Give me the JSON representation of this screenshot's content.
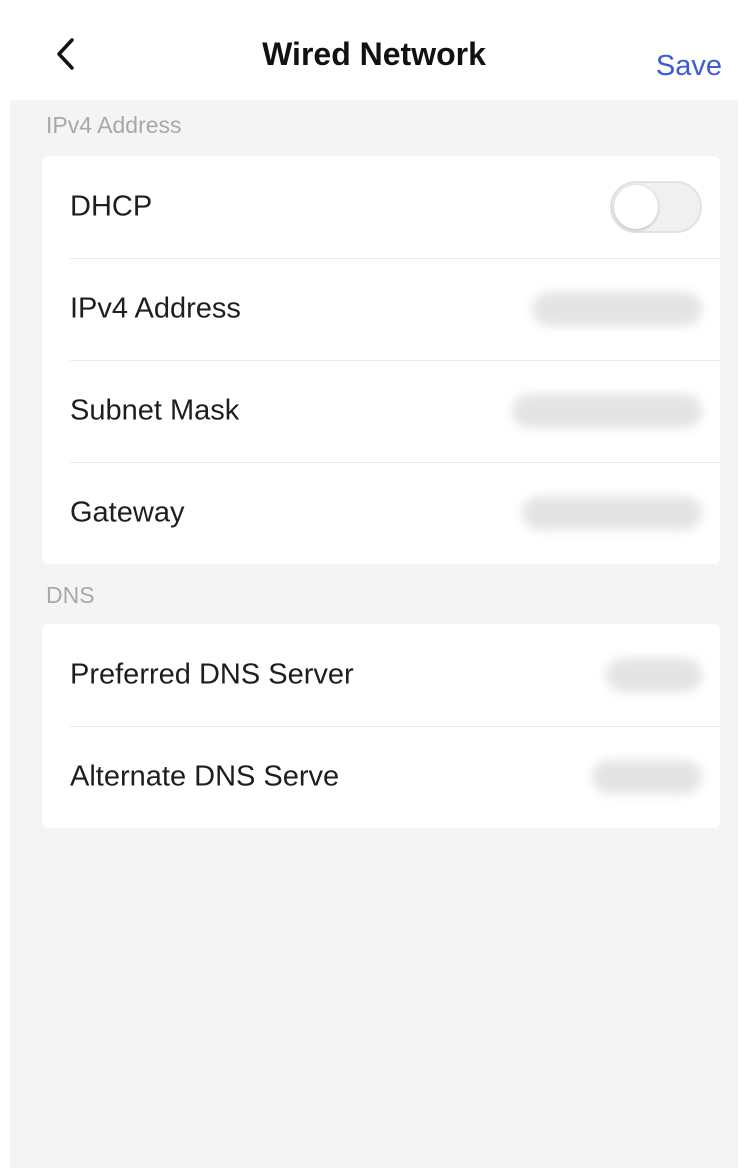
{
  "header": {
    "back_icon": "chevron-left-icon",
    "title": "Wired Network",
    "save_label": "Save"
  },
  "colors": {
    "accent": "#3d5bd4",
    "background": "#f4f4f4",
    "card": "#ffffff",
    "section_label": "#a8a8a8"
  },
  "sections": {
    "ipv4": {
      "label": "IPv4 Address",
      "dhcp": {
        "label": "DHCP",
        "enabled": false
      },
      "ipv4_address": {
        "label": "IPv4 Address",
        "value": ""
      },
      "subnet_mask": {
        "label": "Subnet Mask",
        "value": ""
      },
      "gateway": {
        "label": "Gateway",
        "value": ""
      }
    },
    "dns": {
      "label": "DNS",
      "preferred": {
        "label": "Preferred DNS Server",
        "value": ""
      },
      "alternate": {
        "label": "Alternate DNS Serve",
        "value": ""
      }
    }
  }
}
